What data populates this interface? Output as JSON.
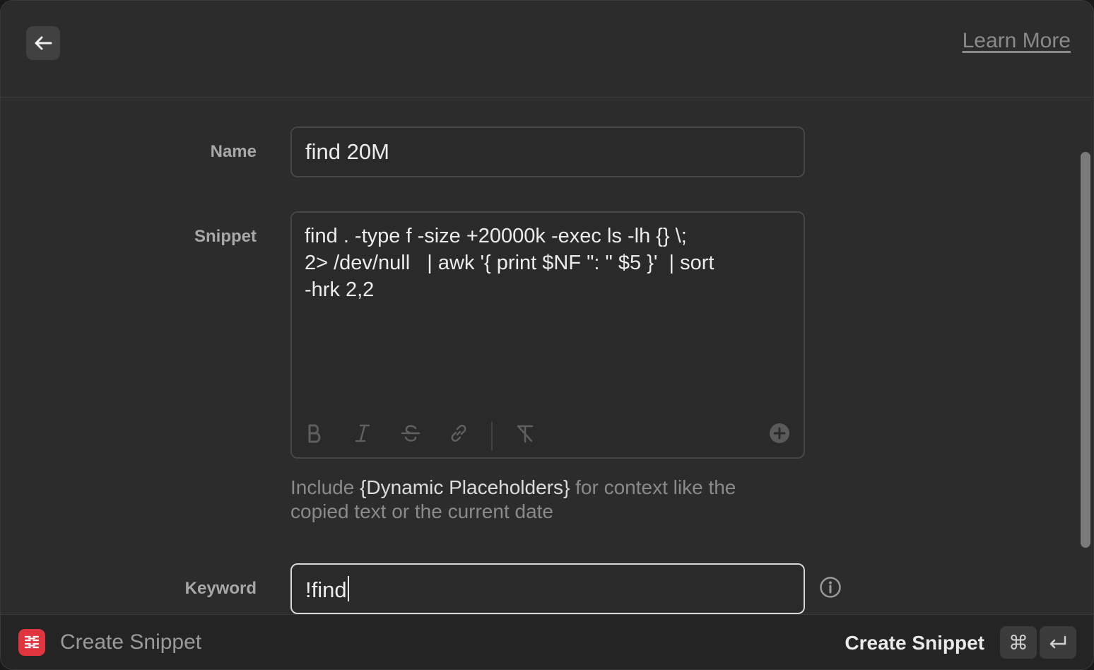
{
  "header": {
    "back_icon": "arrow-left-icon",
    "learn_more": "Learn More"
  },
  "form": {
    "name_label": "Name",
    "name_value": "find 20M",
    "snippet_label": "Snippet",
    "snippet_lines": [
      "find . -type f -size +20000k -exec ls -lh {} \\;",
      "2> /dev/null   | awk '{ print $NF \": \" $5 }'  | sort",
      "-hrk 2,2"
    ],
    "toolbar_icons": [
      "bold-icon",
      "italic-icon",
      "strikethrough-icon",
      "link-icon",
      "clear-format-icon",
      "add-placeholder-icon"
    ],
    "hint_prefix": "Include ",
    "hint_highlight": "{Dynamic Placeholders}",
    "hint_suffix": " for context like the copied text or the current date",
    "keyword_label": "Keyword",
    "keyword_value": "!find",
    "info_icon": "info-icon"
  },
  "footer": {
    "app_icon": "snippets-icon",
    "title": "Create Snippet",
    "action_label": "Create Snippet",
    "shortcut_keys": [
      "⌘",
      "↵"
    ]
  },
  "colors": {
    "background": "#2c2c2c",
    "footer_background": "#242424",
    "app_icon": "#e0343e",
    "muted_text": "#8a8a8a"
  }
}
